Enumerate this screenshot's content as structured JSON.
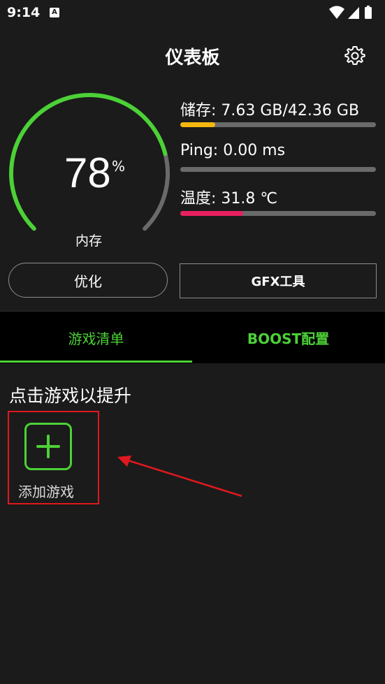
{
  "status_bar": {
    "time": "9:14",
    "notification_icon": "A",
    "icons": [
      "wifi-icon",
      "signal-icon",
      "battery-icon"
    ]
  },
  "header": {
    "title": "仪表板",
    "settings_icon": "gear-icon"
  },
  "gauge": {
    "value": "78",
    "unit": "%",
    "label": "内存",
    "fraction": 0.78,
    "active_color": "#4cd137",
    "inactive_color": "#6a6a6a"
  },
  "stats": [
    {
      "label": "储存: 7.63 GB/42.36 GB",
      "fraction": 0.18,
      "color": "#f5b70f"
    },
    {
      "label": "Ping: 0.00 ms",
      "fraction": 0.0,
      "color": "#4cd137"
    },
    {
      "label": "温度: 31.8 ℃",
      "fraction": 0.32,
      "color": "#e8205f"
    }
  ],
  "buttons": {
    "optimize": "优化",
    "gfx_tool": "GFX工具"
  },
  "tabs": [
    {
      "label": "游戏清单",
      "active": true
    },
    {
      "label": "BOOST配置",
      "active": false
    }
  ],
  "content": {
    "heading": "点击游戏以提升",
    "add_game_label": "添加游戏"
  },
  "colors": {
    "accent": "#4cd137",
    "background": "#1b1b1b",
    "highlight": "#e0181e"
  }
}
